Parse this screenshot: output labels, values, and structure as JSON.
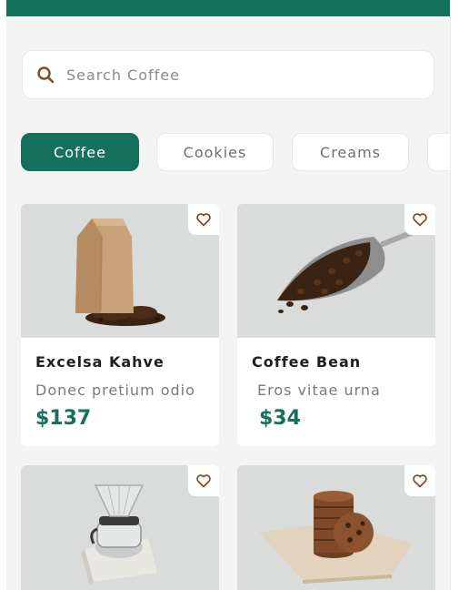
{
  "colors": {
    "accent": "#16705e",
    "background": "#f3f4f3",
    "card": "#ffffff",
    "image_bg": "#d9dcda",
    "heart": "#7a4d34"
  },
  "search": {
    "placeholder": "Search Coffee",
    "icon": "search-icon"
  },
  "categories": [
    {
      "label": "Coffee",
      "active": true
    },
    {
      "label": "Cookies",
      "active": false
    },
    {
      "label": "Creams",
      "active": false
    },
    {
      "label": "",
      "active": false
    }
  ],
  "products": [
    {
      "name": "Excelsa Kahve",
      "description": "Donec pretium odio",
      "price": "$137",
      "image": "kraft-coffee-bag",
      "favorite_icon": "heart-icon"
    },
    {
      "name": "Coffee Bean",
      "description": "Eros vitae urna",
      "price": "$34",
      "image": "scoop-of-coffee-beans",
      "favorite_icon": "heart-icon"
    },
    {
      "name": "",
      "description": "",
      "price": "",
      "image": "pour-over-dripper-on-scale",
      "favorite_icon": "heart-icon"
    },
    {
      "name": "",
      "description": "",
      "price": "",
      "image": "stack-of-cookies-on-board",
      "favorite_icon": "heart-icon"
    }
  ]
}
